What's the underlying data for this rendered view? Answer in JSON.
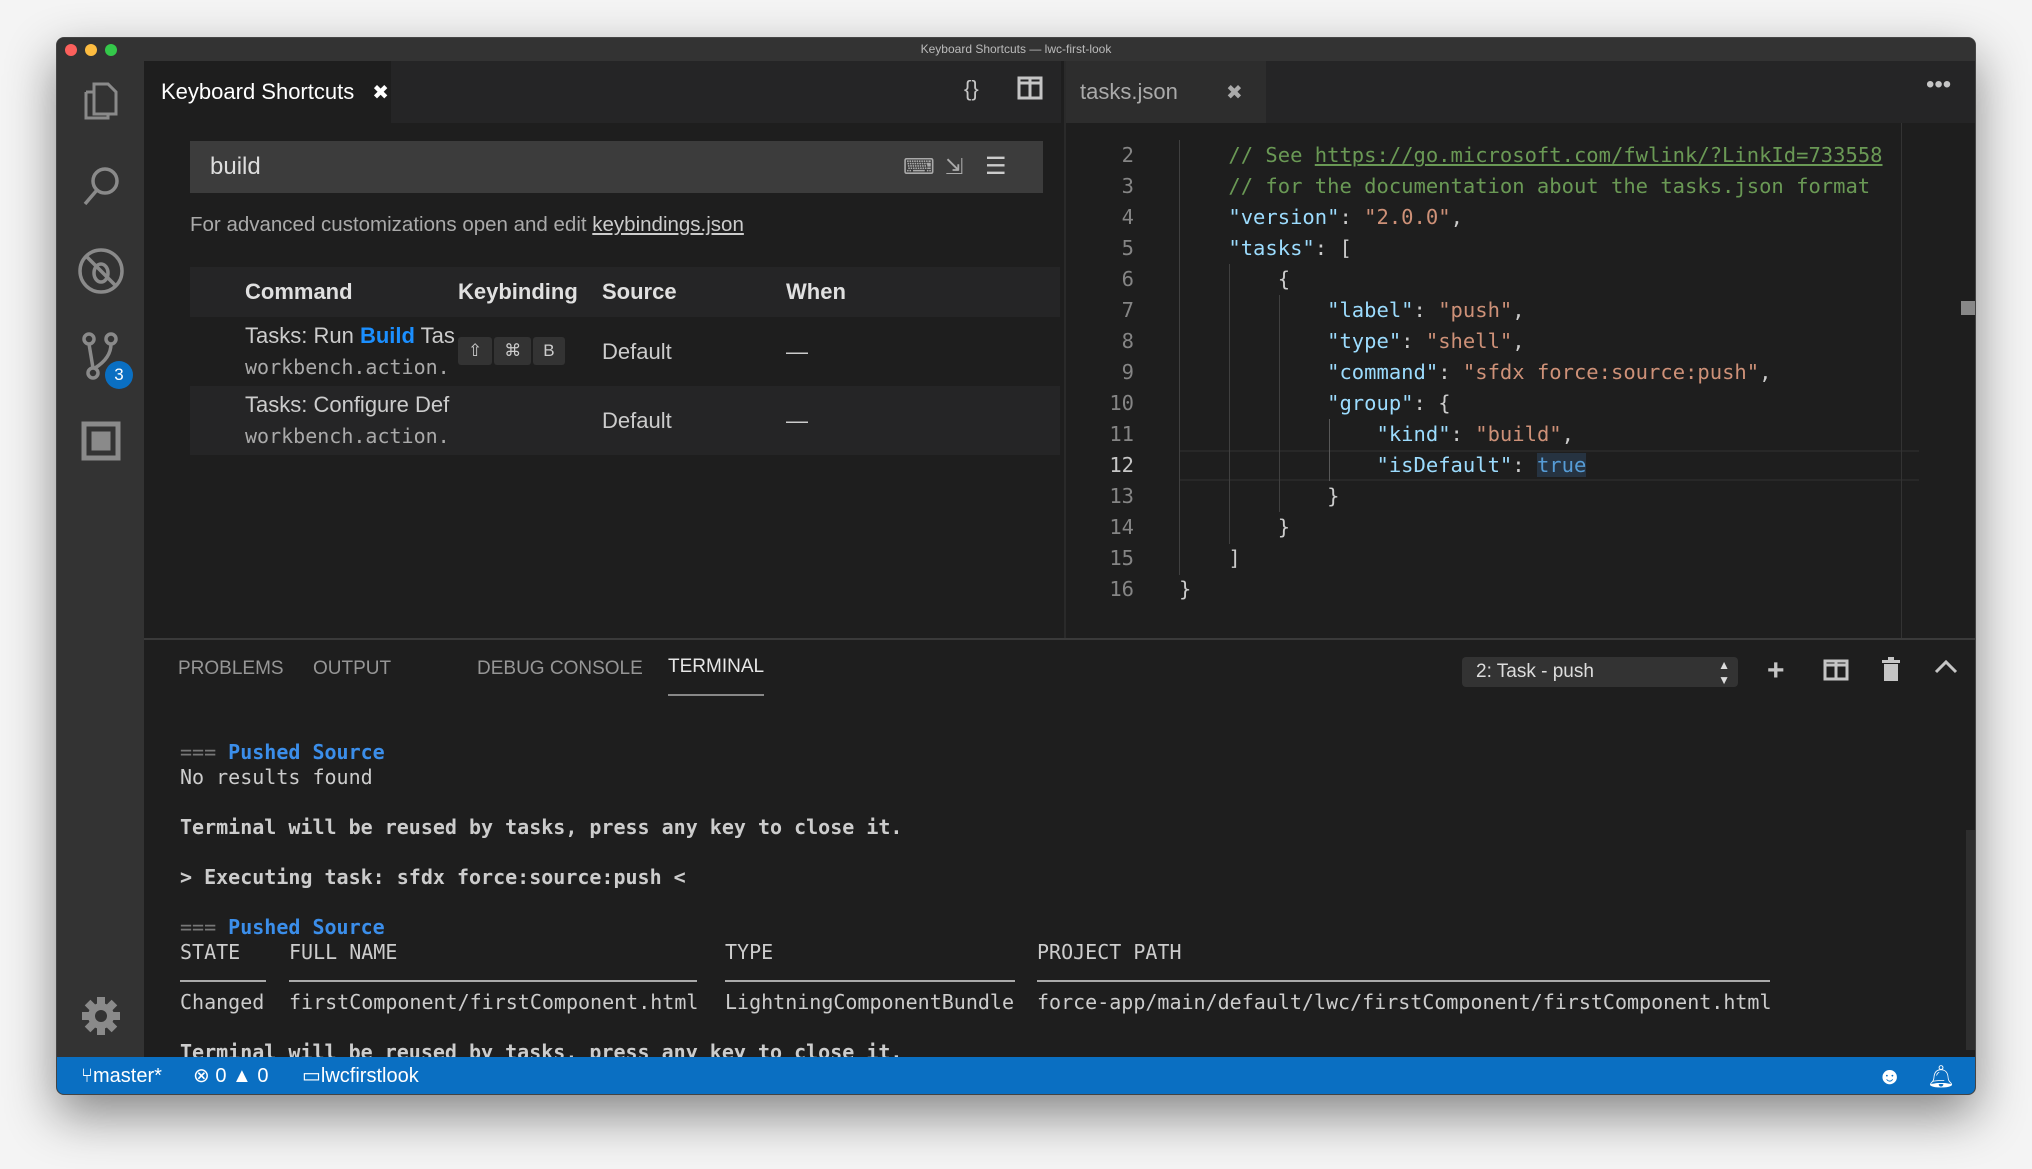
{
  "window": {
    "title": "Keyboard Shortcuts — lwc-first-look"
  },
  "activity_bar": {
    "scm_badge": "3"
  },
  "left_editor": {
    "tab_label": "Keyboard Shortcuts",
    "search_value": "build",
    "hint_text": "For advanced customizations open and edit ",
    "hint_link": "keybindings.json",
    "columns": [
      "Command",
      "Keybinding",
      "Source",
      "When"
    ],
    "rows": [
      {
        "title_prefix": "Tasks: Run ",
        "title_match": "Build",
        "title_suffix": " Tas",
        "id": "workbench.action.",
        "keys": [
          "⇧",
          "⌘",
          "B"
        ],
        "source": "Default",
        "when": "—"
      },
      {
        "title_prefix": "Tasks: Configure Def",
        "title_match": "",
        "title_suffix": "",
        "id": "workbench.action.",
        "keys": [],
        "source": "Default",
        "when": "—"
      }
    ]
  },
  "right_editor": {
    "tab_label": "tasks.json",
    "line_numbers": [
      "2",
      "3",
      "4",
      "5",
      "6",
      "7",
      "8",
      "9",
      "10",
      "11",
      "12",
      "13",
      "14",
      "15",
      "16"
    ],
    "current_line": "12"
  },
  "panel": {
    "tabs": [
      "PROBLEMS",
      "OUTPUT",
      "DEBUG CONSOLE",
      "TERMINAL"
    ],
    "active_tab": "TERMINAL",
    "terminal_select": "2: Task - push",
    "terminal": {
      "heading_prefix": "===",
      "heading": "Pushed Source",
      "no_results": "No results found",
      "reuse": "Terminal will be reused by tasks, press any key to close it.",
      "executing": "> Executing task: sfdx force:source:push <",
      "table_headers": [
        "STATE",
        "FULL NAME",
        "TYPE",
        "PROJECT PATH"
      ],
      "table_row": [
        "Changed",
        "firstComponent/firstComponent.html",
        "LightningComponentBundle",
        "force-app/main/default/lwc/firstComponent/firstComponent.html"
      ]
    }
  },
  "status_bar": {
    "branch": "master*",
    "errors": "0",
    "warnings": "0",
    "folder": "lwcfirstlook"
  },
  "colors": {
    "accent": "#0a6fc2",
    "match": "#1b8fff"
  }
}
